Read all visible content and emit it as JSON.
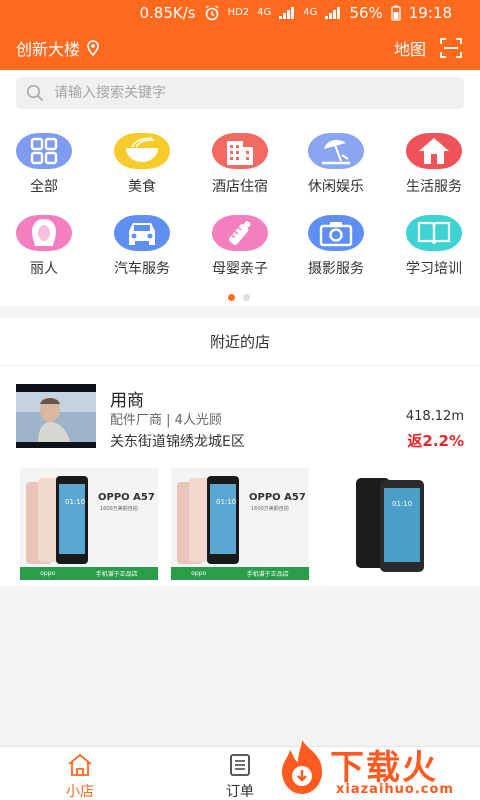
{
  "status_bar": {
    "speed": "0.85K/s",
    "hd": "HD2",
    "net1": "4G",
    "net2": "4G",
    "battery": "56%",
    "time": "19:18"
  },
  "header": {
    "location": "创新大楼",
    "map_label": "地图"
  },
  "search": {
    "placeholder": "请输入搜索关键字"
  },
  "categories": [
    {
      "label": "全部",
      "icon": "grid-icon",
      "color": "#7e9bf0"
    },
    {
      "label": "美食",
      "icon": "noodle-bowl-icon",
      "color": "#f7cc2a"
    },
    {
      "label": "酒店住宿",
      "icon": "hotel-building-icon",
      "color": "#f46a62"
    },
    {
      "label": "休闲娱乐",
      "icon": "beach-umbrella-icon",
      "color": "#8aa6f2"
    },
    {
      "label": "生活服务",
      "icon": "house-icon",
      "color": "#f0525a"
    },
    {
      "label": "丽人",
      "icon": "woman-profile-icon",
      "color": "#f37fbf"
    },
    {
      "label": "汽车服务",
      "icon": "car-icon",
      "color": "#5f8ff2"
    },
    {
      "label": "母婴亲子",
      "icon": "baby-bottle-icon",
      "color": "#f37fbf"
    },
    {
      "label": "摄影服务",
      "icon": "camera-icon",
      "color": "#5f8ff2"
    },
    {
      "label": "学习培训",
      "icon": "open-book-icon",
      "color": "#3fd2d2"
    }
  ],
  "nearby": {
    "title": "附近的店",
    "shop": {
      "name": "用商",
      "meta": "配件厂商 | 4人光顾",
      "distance": "418.12m",
      "address": "关东街道锦绣龙城E区",
      "rebate": "返2.2%"
    },
    "products": [
      {
        "title": "OPPO A57",
        "sub": "1600万美颜自拍",
        "banner_brand": "oppo",
        "banner_text": "手机谱于正品店"
      },
      {
        "title": "OPPO A57",
        "sub": "1600万美颜自拍",
        "banner_brand": "oppo",
        "banner_text": "手机谱于正品店"
      },
      {
        "title": "",
        "sub": ""
      }
    ]
  },
  "tabbar": {
    "tabs": [
      {
        "label": "小店",
        "active": true
      },
      {
        "label": "订单",
        "active": false
      }
    ]
  },
  "watermark": {
    "text": "下载火",
    "url": "xiazaihuo.com"
  },
  "colors": {
    "brand": "#ff6a1f",
    "rebate": "#e8242a"
  }
}
